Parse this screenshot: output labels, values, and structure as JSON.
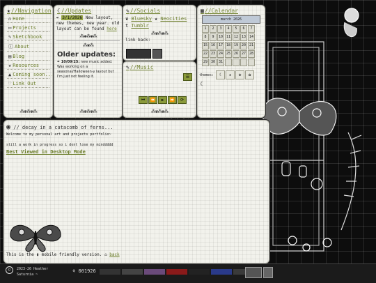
{
  "nav": {
    "title": "//Navigation",
    "items": [
      {
        "label": "Home",
        "icon": "home-icon"
      },
      {
        "label": "Projects",
        "icon": "folder-icon"
      },
      {
        "label": "Sketchbook",
        "icon": "pencil-icon"
      },
      {
        "label": "About",
        "icon": "info-icon"
      },
      {
        "label": "Blog",
        "icon": "book-icon"
      },
      {
        "label": "Resources",
        "icon": "star-icon"
      },
      {
        "label": "Coming soon...",
        "icon": "triangle-icon"
      },
      {
        "label": "Link Out",
        "icon": "heart-icon"
      }
    ]
  },
  "updates": {
    "title": "//Updates",
    "latest_date": "3/1/2026",
    "latest_text": "New layout, new themes, new year. old layout can be found",
    "latest_link": "here",
    "older_title": "Older updates:",
    "older_date": "10/09/25:",
    "older_text": "new music added. Was working on a seasonal/Halloween-y layout but I'm just not feeling it."
  },
  "socials": {
    "title": "//Socials",
    "links": [
      {
        "label": "Bluesky",
        "icon": "butterfly-icon"
      },
      {
        "label": "Neocities",
        "icon": "star-icon"
      },
      {
        "label": "Tumblr",
        "icon": "t-icon"
      }
    ],
    "link_back": "link back:"
  },
  "music": {
    "title": "//Music",
    "controls": [
      "⏮",
      "⏪",
      "▶",
      "⏩",
      "⟳"
    ]
  },
  "calendar": {
    "title": "//Calendar",
    "month_label": "march 2026",
    "days": [
      "1",
      "2",
      "3",
      "4",
      "5",
      "6",
      "7",
      "8",
      "9",
      "10",
      "11",
      "12",
      "13",
      "14",
      "15",
      "16",
      "17",
      "18",
      "19",
      "20",
      "21",
      "22",
      "23",
      "24",
      "25",
      "26",
      "27",
      "28",
      "29",
      "30",
      "31"
    ],
    "themes_label": "themes:",
    "theme_icons": [
      "☾",
      "★",
      "❀",
      "✿"
    ]
  },
  "main": {
    "title": "// decay in a catacomb of ferns...",
    "welcome": "Welcome to my personal art and projects portfolio~",
    "wip": "still a work in progress so i dont lose my minddddd",
    "desktop_note": "Best Viewed in Desktop Mode",
    "mobile_prefix": "This is the",
    "mobile_suffix": "mobile friendly version.",
    "back_label": "back"
  },
  "footer": {
    "copyright_icon": "copyright-icon",
    "credit": "2023-26 Heather Saturnia ~",
    "hit_counter": "001926",
    "badges": [
      "",
      "",
      "",
      "",
      "",
      "",
      "",
      ""
    ]
  },
  "colors": {
    "accent": "#7a8a3c",
    "panel": "#f2f2ec",
    "background": "#0d0d0d"
  }
}
